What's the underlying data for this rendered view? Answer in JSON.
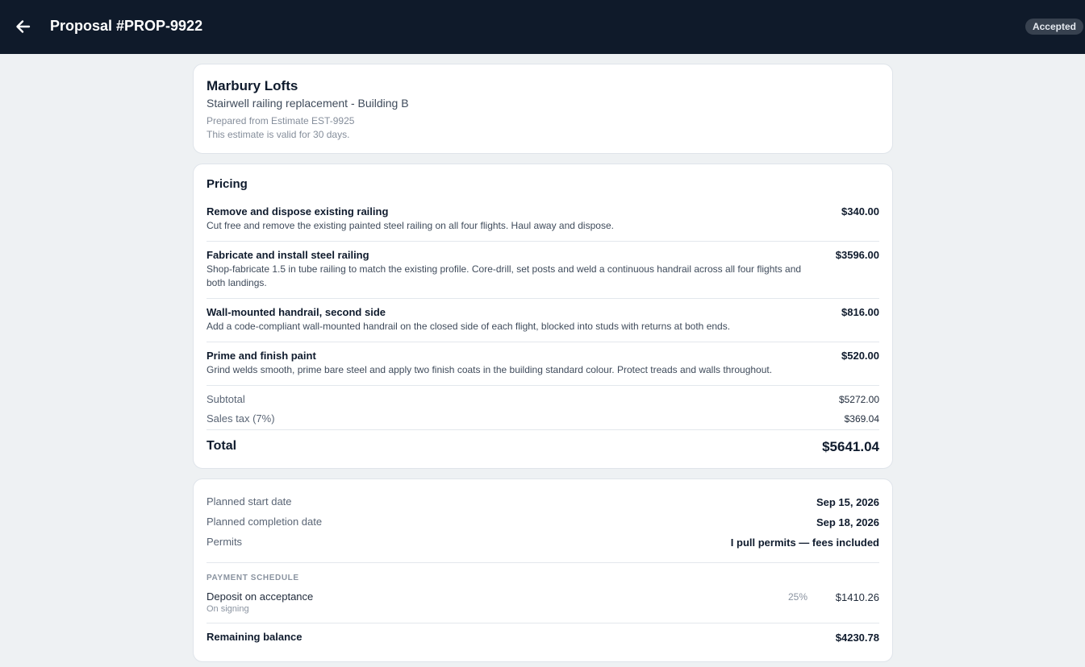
{
  "header": {
    "title": "Proposal #PROP-9922",
    "status": "Accepted"
  },
  "overview": {
    "client": "Marbury Lofts",
    "project": "Stairwell railing replacement - Building B",
    "source": "Prepared from Estimate EST-9925",
    "validity": "This estimate is valid for 30 days."
  },
  "pricing": {
    "title": "Pricing",
    "items": [
      {
        "name": "Remove and dispose existing railing",
        "desc": "Cut free and remove the existing painted steel railing on all four flights. Haul away and dispose.",
        "price": "$340.00"
      },
      {
        "name": "Fabricate and install steel railing",
        "desc": "Shop-fabricate 1.5 in tube railing to match the existing profile. Core-drill, set posts and weld a continuous handrail across all four flights and both landings.",
        "price": "$3596.00"
      },
      {
        "name": "Wall-mounted handrail, second side",
        "desc": "Add a code-compliant wall-mounted handrail on the closed side of each flight, blocked into studs with returns at both ends.",
        "price": "$816.00"
      },
      {
        "name": "Prime and finish paint",
        "desc": "Grind welds smooth, prime bare steel and apply two finish coats in the building standard colour. Protect treads and walls throughout.",
        "price": "$520.00"
      }
    ],
    "subtotal_label": "Subtotal",
    "subtotal": "$5272.00",
    "tax_label": "Sales tax (7%)",
    "tax": "$369.04",
    "total_label": "Total",
    "total": "$5641.04"
  },
  "details": {
    "start_label": "Planned start date",
    "start": "Sep 15, 2026",
    "completion_label": "Planned completion date",
    "completion": "Sep 18, 2026",
    "permits_label": "Permits",
    "permits": "I pull permits — fees included",
    "schedule_title": "PAYMENT SCHEDULE",
    "deposit_label": "Deposit on acceptance",
    "deposit_sub": "On signing",
    "deposit_pct": "25%",
    "deposit_amount": "$1410.26",
    "balance_label": "Remaining balance",
    "balance": "$4230.78"
  }
}
